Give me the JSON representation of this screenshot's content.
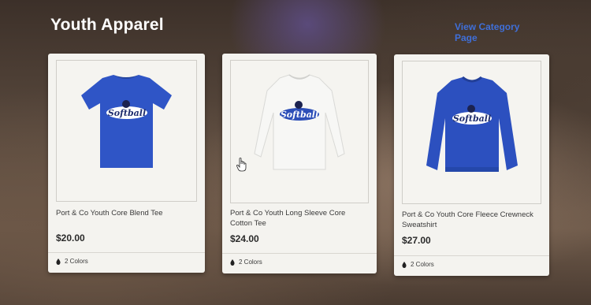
{
  "header": {
    "title": "Youth Apparel",
    "view_link": "View Category Page"
  },
  "products": [
    {
      "name": "Port & Co Youth Core Blend Tee",
      "price": "$20.00",
      "colors": "2 Colors",
      "graphic_text": "Softball",
      "garment_color": "#2f55c6"
    },
    {
      "name": "Port & Co Youth Long Sleeve Core Cotton Tee",
      "price": "$24.00",
      "colors": "2 Colors",
      "graphic_text": "Softball",
      "garment_color": "#f7f7f5"
    },
    {
      "name": "Port & Co Youth Core Fleece Crewneck Sweatshirt",
      "price": "$27.00",
      "colors": "2 Colors",
      "graphic_text": "Softball",
      "garment_color": "#2c50bf"
    }
  ],
  "icons": {
    "color_swatch": "drop-icon",
    "cursor": "hand-cursor-icon"
  },
  "colors": {
    "link": "#3f6fd8",
    "card_bg": "#f4f3ef"
  }
}
